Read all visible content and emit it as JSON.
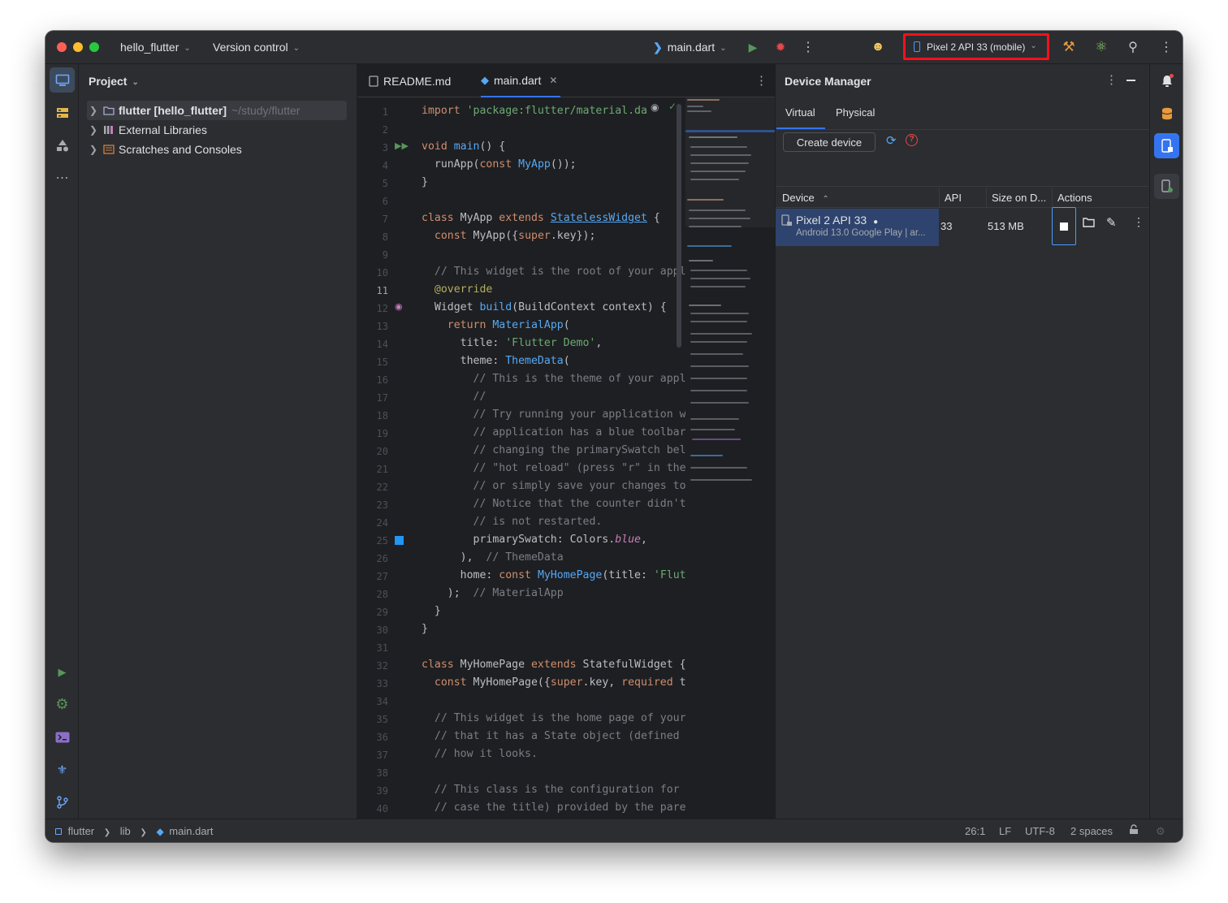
{
  "titlebar": {
    "project_name": "hello_flutter",
    "vcs_label": "Version control",
    "run_config": "main.dart",
    "device": "Pixel 2 API 33 (mobile)"
  },
  "project_panel": {
    "title": "Project",
    "items": [
      {
        "name": "flutter [hello_flutter]",
        "path": "~/study/flutter"
      },
      {
        "name": "External Libraries"
      },
      {
        "name": "Scratches and Consoles"
      }
    ]
  },
  "editor": {
    "tabs": [
      {
        "label": "README.md"
      },
      {
        "label": "main.dart"
      }
    ],
    "current_line": 11
  },
  "device_manager": {
    "title": "Device Manager",
    "tabs": [
      "Virtual",
      "Physical"
    ],
    "create_label": "Create device",
    "columns": {
      "device": "Device",
      "api": "API",
      "size": "Size on D...",
      "actions": "Actions"
    },
    "devices": [
      {
        "name": "Pixel 2 API 33",
        "subtitle": "Android 13.0 Google Play | ar...",
        "api": "33",
        "size": "513 MB"
      }
    ]
  },
  "statusbar": {
    "breadcrumb": [
      "flutter",
      "lib",
      "main.dart"
    ],
    "position": "26:1",
    "line_ending": "LF",
    "encoding": "UTF-8",
    "indent": "2 spaces"
  },
  "colors": {
    "accent": "#3574f0",
    "highlight_border": "#ff0f1b",
    "editor_bg": "#1e1f22",
    "panel_bg": "#2b2d30"
  }
}
